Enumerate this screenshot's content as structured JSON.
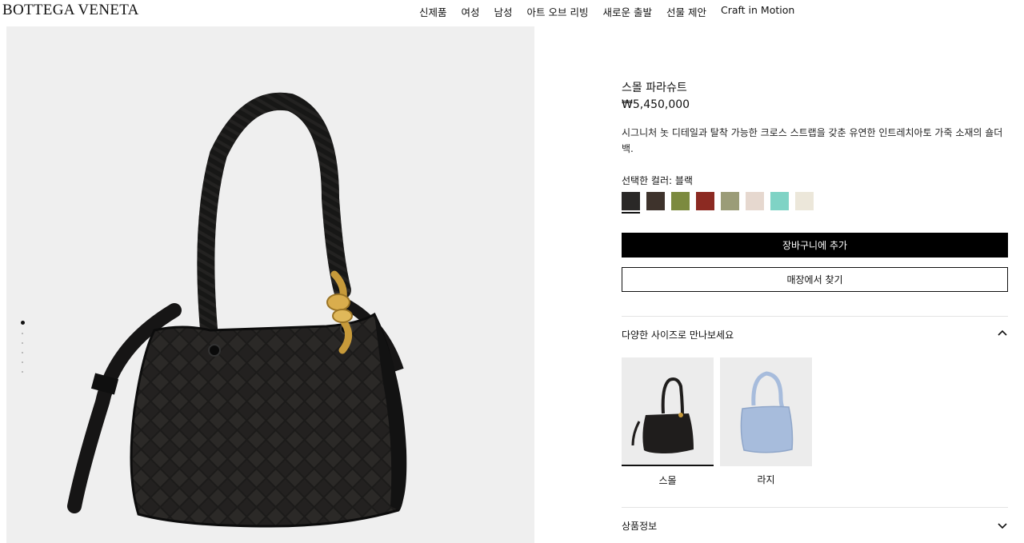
{
  "header": {
    "logo": "BOTTEGA VENETA",
    "nav": [
      "신제품",
      "여성",
      "남성",
      "아트 오브 리빙",
      "새로운 출발",
      "선물 제안",
      "Craft in Motion"
    ]
  },
  "gallery": {
    "slide_count": 6,
    "active_index": 0
  },
  "product": {
    "name": "스몰 파라슈트",
    "price": "₩5,450,000",
    "description": "시그니처 놋 디테일과 탈착 가능한 크로스 스트랩을 갖춘 유연한 인트레치아토 가죽 소재의 숄더백.",
    "selected_color_label": "선택한 컬러: 블랙",
    "swatches": [
      {
        "color": "#2a2827",
        "selected": true
      },
      {
        "color": "#3e332c"
      },
      {
        "color": "#7c8a3f"
      },
      {
        "color": "#8c2a22"
      },
      {
        "color": "#9b9c78"
      },
      {
        "color": "#e6d8cf"
      },
      {
        "color": "#7fd3c5"
      },
      {
        "color": "#ece7da"
      }
    ],
    "add_to_cart": "장바구니에 추가",
    "find_in_store": "매장에서 찾기"
  },
  "sizes": {
    "title": "다양한 사이즈로 만나보세요",
    "options": [
      {
        "label": "스몰",
        "bag_color": "#1f1d1c",
        "selected": true
      },
      {
        "label": "라지",
        "bag_color": "#a7bcdc",
        "selected": false
      }
    ]
  },
  "product_info": {
    "title": "상품정보"
  }
}
